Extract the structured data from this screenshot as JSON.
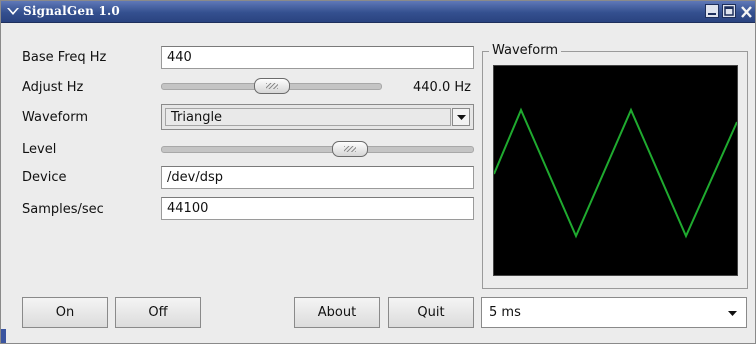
{
  "window": {
    "title": "SignalGen 1.0"
  },
  "form": {
    "base_freq": {
      "label": "Base Freq Hz",
      "value": "440"
    },
    "adjust": {
      "label": "Adjust Hz",
      "value_text": "440.0 Hz",
      "slider_fraction": 0.5
    },
    "waveform": {
      "label": "Waveform",
      "selected": "Triangle"
    },
    "level": {
      "label": "Level",
      "slider_fraction": 0.57
    },
    "device": {
      "label": "Device",
      "value": "/dev/dsp"
    },
    "samples": {
      "label": "Samples/sec",
      "value": "44100"
    }
  },
  "scope_panel": {
    "title": "Waveform",
    "trace_color": "#1faa2f",
    "background": "#000000"
  },
  "buttons": {
    "on": "On",
    "off": "Off",
    "about": "About",
    "quit": "Quit"
  },
  "timebase": {
    "selected": "5 ms"
  },
  "icons": {
    "window_menu": "chevron-down-icon",
    "minimize": "minimize-icon",
    "maximize": "maximize-icon",
    "close": "close-icon"
  }
}
